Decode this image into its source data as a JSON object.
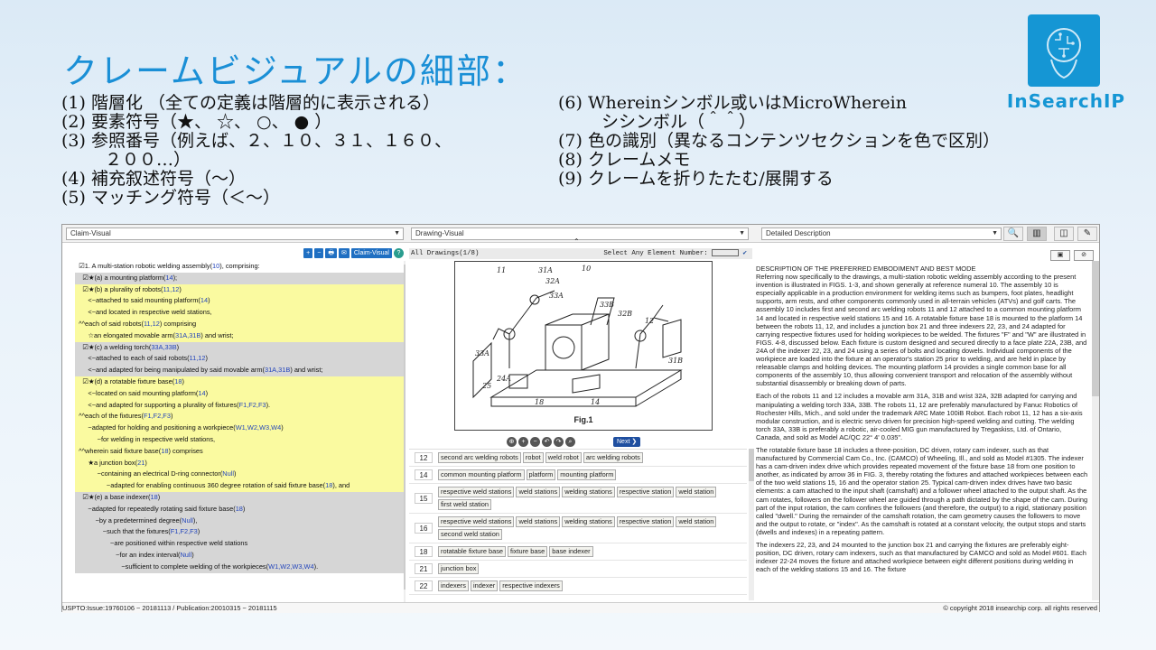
{
  "slide": {
    "title": "クレームビジュアルの細部：",
    "left_items": [
      "(1)  階層化  （全ての定義は階層的に表示される）",
      "(2)  要素符号（★、  ☆、  ○、  ● ）",
      "(3)  参照番号（例えば、２、１０、３１、１６０、",
      "２００…）",
      "(4)  補充叙述符号（～）",
      "(5)  マッチング符号（＜～）"
    ],
    "right_items": [
      "(6)  Whereinシンボル或いはMicroWherein",
      "シシンボル（＾＾）",
      "(7)  色の識別（異なるコンテンツセクションを色で区別）",
      "(8)  クレームメモ",
      "(9)  クレームを折りたたむ/展開する"
    ],
    "logo_text": "InSearchIP"
  },
  "app": {
    "selects": {
      "claim": "Claim-Visual",
      "drawing": "Drawing-Visual",
      "description": "Detailed Description"
    },
    "left_toolbar": [
      "+",
      "−",
      "🖶",
      "✉",
      "Claim-Visual",
      "?"
    ],
    "claims": [
      {
        "t": "  ☑1. A multi-station robotic welding assembly(",
        "r": "10",
        "e": "), comprising:",
        "bg": "white"
      },
      {
        "t": "    ☑★(a) a mounting platform(",
        "r": "14",
        "e": ");",
        "bg": "gray"
      },
      {
        "t": "    ☑★(b) a plurality of robots(",
        "r": "11,12",
        "e": ")",
        "bg": "yel"
      },
      {
        "t": "       <~attached to said mounting platform(",
        "r": "14",
        "e": ")",
        "bg": "yel"
      },
      {
        "t": "       <~and located in respective weld stations,",
        "r": "",
        "e": "",
        "bg": "yel"
      },
      {
        "t": "  ^^each of said robots(",
        "r": "11,12",
        "e": ") comprising",
        "bg": "yel"
      },
      {
        "t": "       ☆an elongated movable arm(",
        "r": "31A,31B",
        "e": ") and wrist;",
        "bg": "yel"
      },
      {
        "t": "    ☑★(c) a welding torch(",
        "r": "33A,33B",
        "e": ")",
        "bg": "gray"
      },
      {
        "t": "       <~attached to each of said robots(",
        "r": "11,12",
        "e": ")",
        "bg": "gray"
      },
      {
        "t": "       <~and adapted for being manipulated by said movable arm(",
        "r": "31A,31B",
        "e": ") and wrist;",
        "bg": "gray"
      },
      {
        "t": "    ☑★(d) a rotatable fixture base(",
        "r": "18",
        "e": ")",
        "bg": "yel"
      },
      {
        "t": "       <~located on said mounting platform(",
        "r": "14",
        "e": ")",
        "bg": "yel"
      },
      {
        "t": "       <~and adapted for supporting a plurality of fixtures(",
        "r": "F1,F2,F3",
        "e": ").",
        "bg": "yel"
      },
      {
        "t": "  ^^each of the fixtures(",
        "r": "F1,F2,F3",
        "e": ")",
        "bg": "yel"
      },
      {
        "t": "       ~adapted for holding and positioning a workpiece(",
        "r": "W1,W2,W3,W4",
        "e": ")",
        "bg": "yel"
      },
      {
        "t": "            ~for welding in respective weld stations,",
        "r": "",
        "e": "",
        "bg": "yel"
      },
      {
        "t": "  ^^wherein said fixture base(",
        "r": "18",
        "e": ") comprises",
        "bg": "yel"
      },
      {
        "t": "       ★a junction box(",
        "r": "21",
        "e": ")",
        "bg": "yel"
      },
      {
        "t": "            ~containing an electrical D-ring connector(",
        "r": "Null",
        "e": ")",
        "bg": "yel"
      },
      {
        "t": "                 ~adapted for enabling continuous 360 degree rotation of said fixture base(",
        "r": "18",
        "e": "), and",
        "bg": "yel"
      },
      {
        "t": "    ☑★(e) a base indexer(",
        "r": "18",
        "e": ")",
        "bg": "gray"
      },
      {
        "t": "       ~adapted for repeatedly rotating said fixture base(",
        "r": "18",
        "e": ")",
        "bg": "gray"
      },
      {
        "t": "           ~by a predetermined degree(",
        "r": "Null",
        "e": "),",
        "bg": "gray"
      },
      {
        "t": "               ~such that the fixtures(",
        "r": "F1,F2,F3",
        "e": ")",
        "bg": "gray"
      },
      {
        "t": "                   ~are positioned within respective weld stations",
        "r": "",
        "e": "",
        "bg": "gray"
      },
      {
        "t": "                      ~for an index interval(",
        "r": "Null",
        "e": ")",
        "bg": "gray"
      },
      {
        "t": "                         ~sufficient to complete welding of the workpieces(",
        "r": "W1,W2,W3,W4",
        "e": ").",
        "bg": "gray"
      }
    ],
    "drawing_head_left": "All Drawings(1/8)",
    "drawing_head_right": "Select Any Element Number:",
    "figure_label": "Fig.1",
    "next_label": "Next",
    "elements": [
      {
        "num": "12",
        "tags": [
          "second arc welding robots",
          "robot",
          "weld robot",
          "arc welding robots"
        ]
      },
      {
        "num": "14",
        "tags": [
          "common mounting platform",
          "platform",
          "mounting platform"
        ]
      },
      {
        "num": "15",
        "tags": [
          "respective weld stations",
          "weld stations",
          "welding stations",
          "respective station",
          "weld station",
          "first weld station"
        ]
      },
      {
        "num": "16",
        "tags": [
          "respective weld stations",
          "weld stations",
          "welding stations",
          "respective station",
          "weld station",
          "second weld station"
        ]
      },
      {
        "num": "18",
        "tags": [
          "rotatable fixture base",
          "fixture base",
          "base indexer"
        ]
      },
      {
        "num": "21",
        "tags": [
          "junction box"
        ]
      },
      {
        "num": "22",
        "tags": [
          "indexers",
          "indexer",
          "respective indexers"
        ]
      }
    ],
    "description": [
      "DESCRIPTION OF THE PREFERRED EMBODIMENT AND BEST MODE",
      "Referring now specifically to the drawings, a multi-station robotic welding assembly according to the present invention is illustrated in FIGS. 1-3, and shown generally at reference numeral 10. The assembly 10 is especially applicable in a production environment for welding items such as bumpers, foot plates, headlight supports, arm rests, and other components commonly used in all-terrain vehicles (ATVs) and golf carts. The assembly 10 includes first and second arc welding robots 11 and 12 attached to a common mounting platform 14 and located in respective weld stations 15 and 16. A rotatable fixture base 18 is mounted to the platform 14 between the robots 11, 12, and includes a junction box 21 and three indexers 22, 23, and 24 adapted for carrying respective fixtures used for holding workpieces to be welded. The fixtures \"F\" and \"W\" are illustrated in FIGS. 4-8, discussed below. Each fixture is custom designed and secured directly to a face plate 22A, 23B, and 24A of the indexer 22, 23, and 24 using a series of bolts and locating dowels. Individual components of the workpiece are loaded into the fixture at an operator's station 25 prior to welding, and are held in place by releasable clamps and holding devices. The mounting platform 14 provides a single common base for all components of the assembly 10, thus allowing convenient transport and relocation of the assembly without substantial disassembly or breaking down of parts.",
      "Each of the robots 11 and 12 includes a movable arm 31A, 31B and wrist 32A, 32B adapted for carrying and manipulating a welding torch 33A, 33B. The robots 11, 12 are preferably manufactured by Fanuc Robotics of Rochester Hills, Mich., and sold under the trademark ARC Mate 100iB Robot. Each robot 11, 12 has a six-axis modular construction, and is electric servo driven for precision high-speed welding and cutting. The welding torch 33A, 33B is preferably a robotic, air-cooled MIG gun manufactured by Tregaskiss, Ltd. of Ontario, Canada, and sold as Model AC/QC 22° 4' 0.035\".",
      "The rotatable fixture base 18 includes a three-position, DC driven, rotary cam indexer, such as that manufactured by Commercial Cam Co., Inc. (CAMCO) of Wheeling, Ill., and sold as Model #1305. The indexer has a cam-driven index drive which provides repeated movement of the fixture base 18 from one position to another, as indicated by arrow 36 in FIG. 3, thereby rotating the fixtures and attached workpieces between each of the two weld stations 15, 16 and the operator station 25. Typical cam-driven index drives have two basic elements: a cam attached to the input shaft (camshaft) and a follower wheel attached to the output shaft. As the cam rotates, followers on the follower wheel are guided through a path dictated by the shape of the cam. During part of the input rotation, the cam confines the followers (and therefore, the output) to a rigid, stationary position called \"dwell.\" During the remainder of the camshaft rotation, the cam geometry causes the followers to move and the output to rotate, or \"index\". As the camshaft is rotated at a constant velocity, the output stops and starts (dwells and indexes) in a repeating pattern.",
      "The indexers 22, 23, and 24 mounted to the junction box 21 and carrying the fixtures are preferably eight-position, DC driven, rotary cam indexers, such as that manufactured by CAMCO and sold as Model #601. Each indexer 22-24 moves the fixture and attached workpiece between eight different positions during welding in each of the welding stations 15 and 16. The fixture"
    ],
    "footer_left": "USPTO:Issue:19760106 ~ 20181113 / Publication:20010315 ~ 20181115",
    "footer_right": "© copyright 2018 insearchip corp. all rights reserved"
  }
}
